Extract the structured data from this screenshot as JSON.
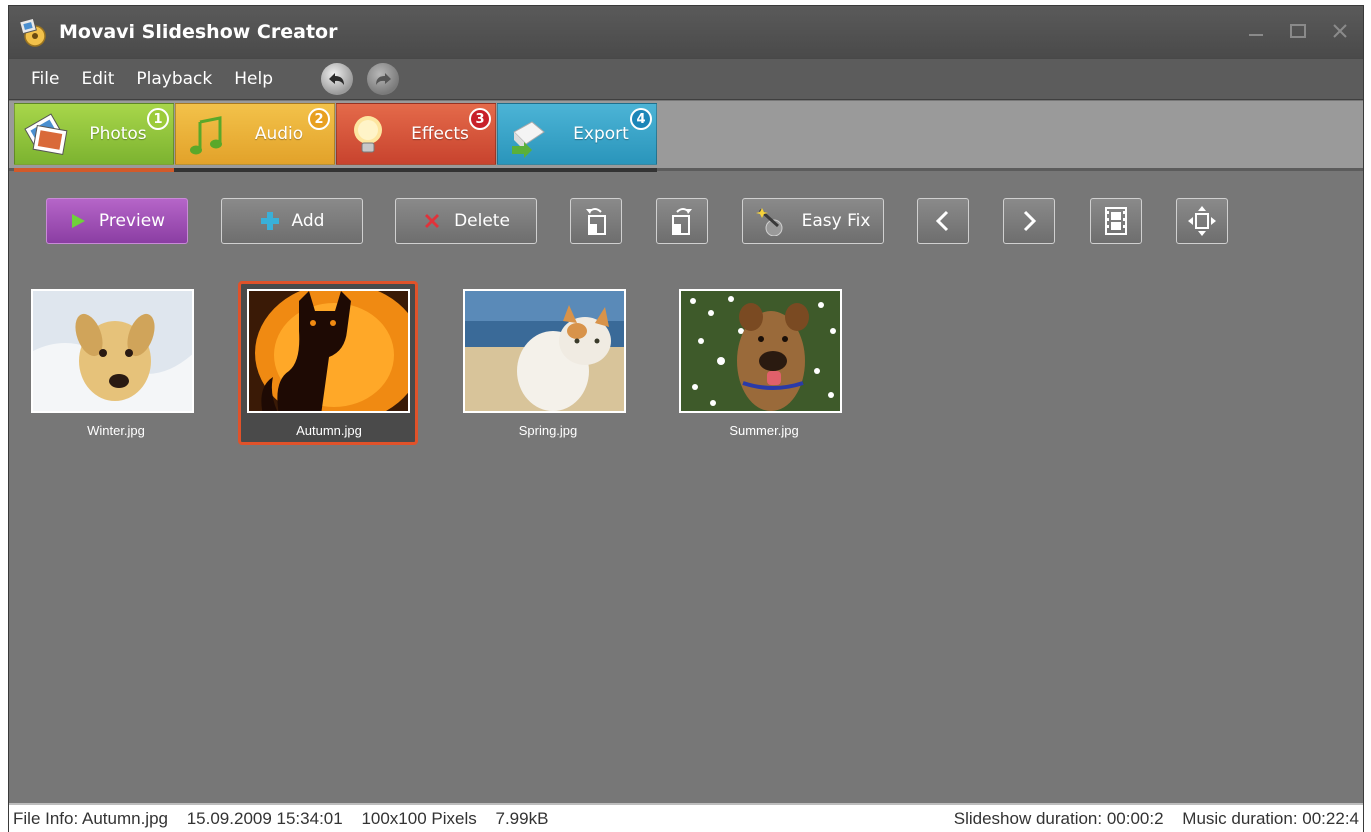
{
  "window": {
    "title": "Movavi Slideshow Creator"
  },
  "menu": {
    "items": [
      "File",
      "Edit",
      "Playback",
      "Help"
    ]
  },
  "tabs": [
    {
      "label": "Photos",
      "badge": "1",
      "color": "#7cb330"
    },
    {
      "label": "Audio",
      "badge": "2",
      "color": "#e2a22a"
    },
    {
      "label": "Effects",
      "badge": "3",
      "color": "#c8432e"
    },
    {
      "label": "Export",
      "badge": "4",
      "color": "#2a95bb"
    }
  ],
  "toolbar": {
    "preview_label": "Preview",
    "add_label": "Add",
    "delete_label": "Delete",
    "easyfix_label": "Easy Fix"
  },
  "photos": [
    {
      "caption": "Winter.jpg",
      "selected": false
    },
    {
      "caption": "Autumn.jpg",
      "selected": true
    },
    {
      "caption": "Spring.jpg",
      "selected": false
    },
    {
      "caption": "Summer.jpg",
      "selected": false
    }
  ],
  "status": {
    "file_info": "File Info: Autumn.jpg",
    "date": "15.09.2009 15:34:01",
    "dimensions": "100x100 Pixels",
    "size": "7.99kB",
    "slideshow_duration": "Slideshow duration: 00:00:2",
    "music_duration": "Music duration: 00:22:4"
  },
  "colors": {
    "accent_selected": "#e0522a",
    "preview_button": "#8b3ea3",
    "workspace": "#777777"
  }
}
